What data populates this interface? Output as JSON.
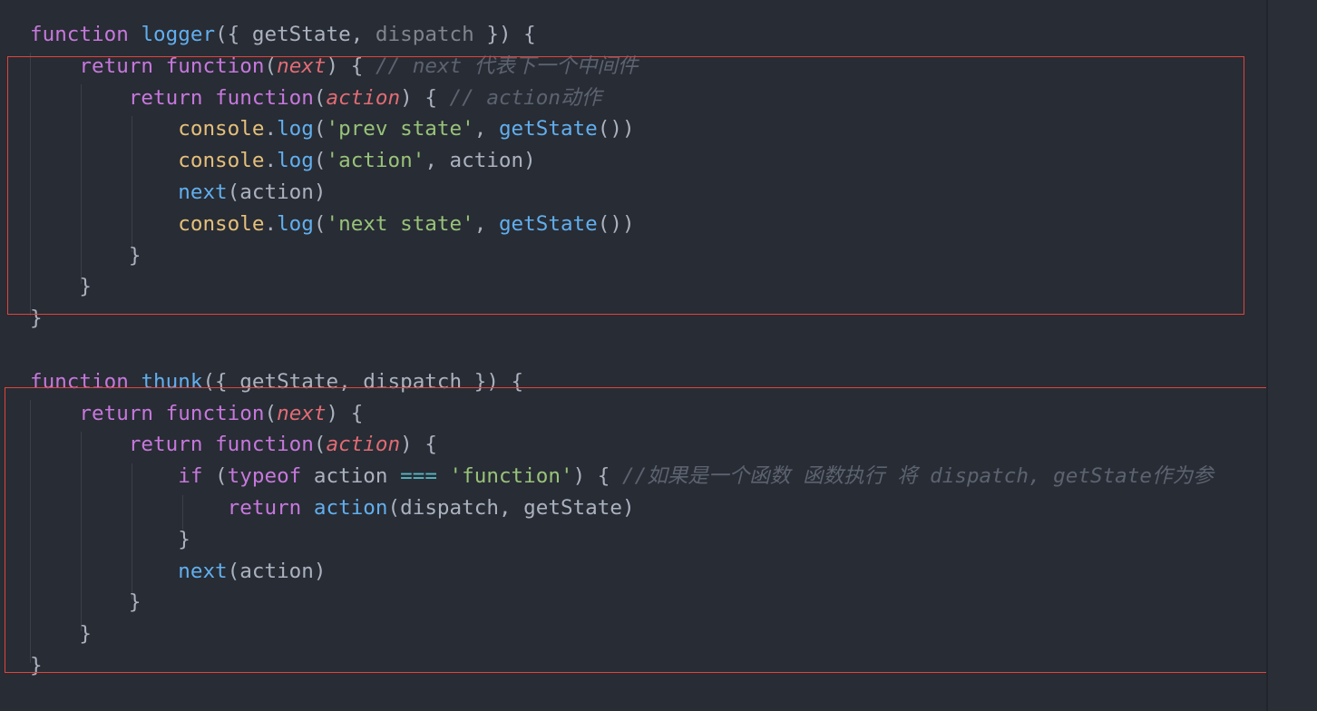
{
  "editor": {
    "theme_colors": {
      "background": "#282c34",
      "keyword": "#c678dd",
      "function": "#61afef",
      "parameter": "#e06c75",
      "string": "#98c379",
      "class": "#e5c07b",
      "comment": "#5c6370",
      "highlight_border": "#e0443a"
    },
    "lines": [
      [
        {
          "t": "function",
          "c": "kw"
        },
        {
          "t": " "
        },
        {
          "t": "logger",
          "c": "fn"
        },
        {
          "t": "({ getState, "
        },
        {
          "t": "dispatch",
          "c": "dim"
        },
        {
          "t": " }) {"
        }
      ],
      [
        {
          "t": "    "
        },
        {
          "t": "return",
          "c": "kw"
        },
        {
          "t": " "
        },
        {
          "t": "function",
          "c": "kw"
        },
        {
          "t": "("
        },
        {
          "t": "next",
          "c": "param"
        },
        {
          "t": ") { "
        },
        {
          "t": "// next 代表下一个中间件",
          "c": "cmt"
        }
      ],
      [
        {
          "t": "        "
        },
        {
          "t": "return",
          "c": "kw"
        },
        {
          "t": " "
        },
        {
          "t": "function",
          "c": "kw"
        },
        {
          "t": "("
        },
        {
          "t": "action",
          "c": "param"
        },
        {
          "t": ") { "
        },
        {
          "t": "// action动作",
          "c": "cmt"
        }
      ],
      [
        {
          "t": "            "
        },
        {
          "t": "console",
          "c": "cls"
        },
        {
          "t": "."
        },
        {
          "t": "log",
          "c": "fn"
        },
        {
          "t": "("
        },
        {
          "t": "'prev state'",
          "c": "str"
        },
        {
          "t": ", "
        },
        {
          "t": "getState",
          "c": "fn"
        },
        {
          "t": "())"
        }
      ],
      [
        {
          "t": "            "
        },
        {
          "t": "console",
          "c": "cls"
        },
        {
          "t": "."
        },
        {
          "t": "log",
          "c": "fn"
        },
        {
          "t": "("
        },
        {
          "t": "'action'",
          "c": "str"
        },
        {
          "t": ", action)"
        }
      ],
      [
        {
          "t": "            "
        },
        {
          "t": "next",
          "c": "fn"
        },
        {
          "t": "(action)"
        }
      ],
      [
        {
          "t": "            "
        },
        {
          "t": "console",
          "c": "cls"
        },
        {
          "t": "."
        },
        {
          "t": "log",
          "c": "fn"
        },
        {
          "t": "("
        },
        {
          "t": "'next state'",
          "c": "str"
        },
        {
          "t": ", "
        },
        {
          "t": "getState",
          "c": "fn"
        },
        {
          "t": "())"
        }
      ],
      [
        {
          "t": "        }"
        }
      ],
      [
        {
          "t": "    }"
        }
      ],
      [
        {
          "t": "}"
        }
      ],
      [
        {
          "t": ""
        }
      ],
      [
        {
          "t": "function",
          "c": "kw"
        },
        {
          "t": " "
        },
        {
          "t": "thunk",
          "c": "fn"
        },
        {
          "t": "({ getState, dispatch }) {"
        }
      ],
      [
        {
          "t": "    "
        },
        {
          "t": "return",
          "c": "kw"
        },
        {
          "t": " "
        },
        {
          "t": "function",
          "c": "kw"
        },
        {
          "t": "("
        },
        {
          "t": "next",
          "c": "param"
        },
        {
          "t": ") {"
        }
      ],
      [
        {
          "t": "        "
        },
        {
          "t": "return",
          "c": "kw"
        },
        {
          "t": " "
        },
        {
          "t": "function",
          "c": "kw"
        },
        {
          "t": "("
        },
        {
          "t": "action",
          "c": "param"
        },
        {
          "t": ") {"
        }
      ],
      [
        {
          "t": "            "
        },
        {
          "t": "if",
          "c": "kw"
        },
        {
          "t": " ("
        },
        {
          "t": "typeof",
          "c": "kw"
        },
        {
          "t": " action "
        },
        {
          "t": "===",
          "c": "op"
        },
        {
          "t": " "
        },
        {
          "t": "'function'",
          "c": "str"
        },
        {
          "t": ") { "
        },
        {
          "t": "//如果是一个函数 函数执行 将 dispatch, getState作为参",
          "c": "cmt"
        }
      ],
      [
        {
          "t": "                "
        },
        {
          "t": "return",
          "c": "kw"
        },
        {
          "t": " "
        },
        {
          "t": "action",
          "c": "fn"
        },
        {
          "t": "(dispatch, getState)"
        }
      ],
      [
        {
          "t": "            }"
        }
      ],
      [
        {
          "t": "            "
        },
        {
          "t": "next",
          "c": "fn"
        },
        {
          "t": "(action)"
        }
      ],
      [
        {
          "t": "        }"
        }
      ],
      [
        {
          "t": "    }"
        }
      ],
      [
        {
          "t": "}"
        }
      ]
    ]
  }
}
